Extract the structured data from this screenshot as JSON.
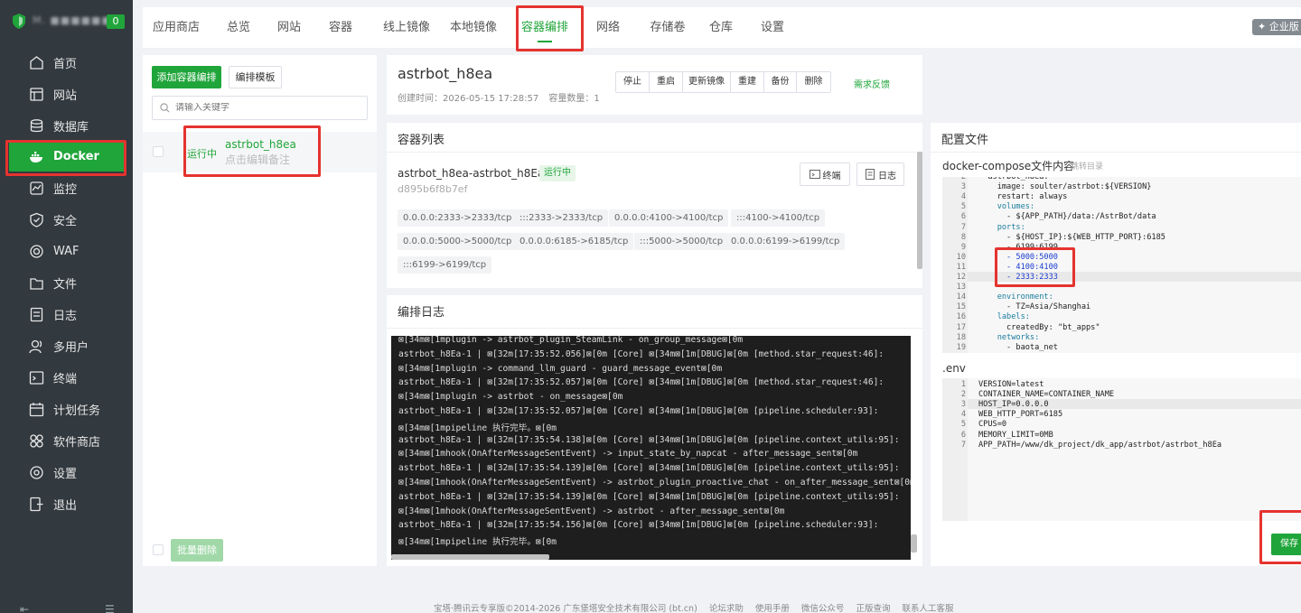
{
  "brand": {
    "name": "M. ■■■■■■",
    "badge": "0"
  },
  "sidebar": {
    "items": [
      {
        "label": "首页",
        "icon": "home-icon"
      },
      {
        "label": "网站",
        "icon": "website-icon"
      },
      {
        "label": "数据库",
        "icon": "database-icon"
      },
      {
        "label": "Docker",
        "icon": "docker-icon"
      },
      {
        "label": "监控",
        "icon": "monitor-icon"
      },
      {
        "label": "安全",
        "icon": "shield-icon"
      },
      {
        "label": "WAF",
        "icon": "waf-icon"
      },
      {
        "label": "文件",
        "icon": "folder-icon"
      },
      {
        "label": "日志",
        "icon": "log-icon"
      },
      {
        "label": "多用户",
        "icon": "user-icon"
      },
      {
        "label": "终端",
        "icon": "terminal-icon"
      },
      {
        "label": "计划任务",
        "icon": "calendar-icon"
      },
      {
        "label": "软件商店",
        "icon": "apps-icon"
      },
      {
        "label": "设置",
        "icon": "gear-icon"
      },
      {
        "label": "退出",
        "icon": "exit-icon"
      }
    ],
    "active": "Docker"
  },
  "tabs": [
    "应用商店",
    "总览",
    "网站",
    "容器",
    "线上镜像",
    "本地镜像",
    "容器编排",
    "网络",
    "存储卷",
    "仓库",
    "设置"
  ],
  "active_tab": "容器编排",
  "enterprise_label": "企业版",
  "left": {
    "add_button": "添加容器编排",
    "template_button": "编排模板",
    "search_placeholder": "请输入关键字",
    "item": {
      "status": "运行中",
      "name": "astrbot_h8ea",
      "note": "点击编辑备注"
    },
    "batch_delete": "批量删除"
  },
  "detail": {
    "title": "astrbot_h8ea",
    "created_label": "创建时间：",
    "created_value": "2026-05-15 17:28:57",
    "count_label": "容量数量：",
    "count_value": "1",
    "actions": [
      "停止",
      "重启",
      "更新镜像",
      "重建",
      "备份",
      "删除"
    ],
    "feedback": "需求反馈"
  },
  "containers": {
    "title": "容器列表",
    "name": "astrbot_h8ea-astrbot_h8Ea-1",
    "status": "运行中",
    "id": "d895b6f8b7ef",
    "terminal_btn": "终端",
    "log_btn": "日志",
    "ports": [
      "0.0.0.0:2333->2333/tcp",
      ":::2333->2333/tcp",
      "0.0.0.0:4100->4100/tcp",
      ":::4100->4100/tcp",
      "0.0.0.0:5000->5000/tcp",
      "0.0.0.0:6185->6185/tcp",
      ":::5000->5000/tcp",
      "0.0.0.0:6199->6199/tcp",
      ":::6199->6199/tcp"
    ]
  },
  "log": {
    "title": "编排日志",
    "lines": [
      "⊠[34m⊠[1mplugin -> astrbot_plugin_SteamLink - on_group_message⊠[0m",
      "astrbot_h8Ea-1 | ⊠[32m[17:35:52.056]⊠[0m [Core] ⊠[34m⊠[1m[DBUG]⊠[0m [method.star_request:46]:",
      "⊠[34m⊠[1mplugin -> command_llm_guard - guard_message_event⊠[0m",
      "astrbot_h8Ea-1 | ⊠[32m[17:35:52.057]⊠[0m [Core] ⊠[34m⊠[1m[DBUG]⊠[0m [method.star_request:46]:",
      "⊠[34m⊠[1mplugin -> astrbot - on_message⊠[0m",
      "astrbot_h8Ea-1 | ⊠[32m[17:35:52.057]⊠[0m [Core] ⊠[34m⊠[1m[DBUG]⊠[0m [pipeline.scheduler:93]:",
      "⊠[34m⊠[1mpipeline 执行完毕。⊠[0m",
      "astrbot_h8Ea-1 | ⊠[32m[17:35:54.138]⊠[0m [Core] ⊠[34m⊠[1m[DBUG]⊠[0m [pipeline.context_utils:95]:",
      "⊠[34m⊠[1mhook(OnAfterMessageSentEvent) -> input_state_by_napcat - after_message_sent⊠[0m",
      "astrbot_h8Ea-1 | ⊠[32m[17:35:54.139]⊠[0m [Core] ⊠[34m⊠[1m[DBUG]⊠[0m [pipeline.context_utils:95]:",
      "⊠[34m⊠[1mhook(OnAfterMessageSentEvent) -> astrbot_plugin_proactive_chat - on_after_message_sent⊠[0m",
      "astrbot_h8Ea-1 | ⊠[32m[17:35:54.139]⊠[0m [Core] ⊠[34m⊠[1m[DBUG]⊠[0m [pipeline.context_utils:95]:",
      "⊠[34m⊠[1mhook(OnAfterMessageSentEvent) -> astrbot - after_message_sent⊠[0m",
      "astrbot_h8Ea-1 | ⊠[32m[17:35:54.156]⊠[0m [Core] ⊠[34m⊠[1m[DBUG]⊠[0m [pipeline.scheduler:93]:",
      "⊠[34m⊠[1mpipeline 执行完毕。⊠[0m"
    ]
  },
  "config": {
    "title": "配置文件",
    "compose_label": "docker-compose文件内容",
    "jump_link": "跳转目录",
    "compose_lines": [
      {
        "n": "2",
        "t": "  astrbot_h8ea:"
      },
      {
        "n": "3",
        "t": "    image: soulter/astrbot:${VERSION}"
      },
      {
        "n": "4",
        "t": "    restart: always"
      },
      {
        "n": "5",
        "t": "    volumes:"
      },
      {
        "n": "6",
        "t": "      - ${APP_PATH}/data:/AstrBot/data"
      },
      {
        "n": "7",
        "t": "    ports:"
      },
      {
        "n": "8",
        "t": "      - ${HOST_IP}:${WEB_HTTP_PORT}:6185"
      },
      {
        "n": "9",
        "t": "      - 6199:6199"
      },
      {
        "n": "10",
        "t": "      - 5000:5000"
      },
      {
        "n": "11",
        "t": "      - 4100:4100"
      },
      {
        "n": "12",
        "t": "      - 2333:2333"
      },
      {
        "n": "13",
        "t": ""
      },
      {
        "n": "14",
        "t": "    environment:"
      },
      {
        "n": "15",
        "t": "      - TZ=Asia/Shanghai"
      },
      {
        "n": "16",
        "t": "    labels:"
      },
      {
        "n": "17",
        "t": "      createdBy: \"bt_apps\""
      },
      {
        "n": "18",
        "t": "    networks:"
      },
      {
        "n": "19",
        "t": "      - baota_net"
      }
    ],
    "env_label": ".env",
    "env_lines": [
      {
        "n": "1",
        "t": "VERSION=latest"
      },
      {
        "n": "2",
        "t": "CONTAINER_NAME=CONTAINER_NAME"
      },
      {
        "n": "3",
        "t": "HOST_IP=0.0.0.0"
      },
      {
        "n": "4",
        "t": "WEB_HTTP_PORT=6185"
      },
      {
        "n": "5",
        "t": "CPUS=0"
      },
      {
        "n": "6",
        "t": "MEMORY_LIMIT=0MB"
      },
      {
        "n": "7",
        "t": "APP_PATH=/www/dk_project/dk_app/astrbot/astrbot_h8Ea"
      }
    ],
    "save_button": "保存"
  },
  "footer": {
    "copyright": "宝塔·腾讯云专享版©2014-2026 广东堡塔安全技术有限公司 (bt.cn)",
    "links": [
      "论坛求助",
      "使用手册",
      "微信公众号",
      "正版查询",
      "联系人工客服"
    ]
  },
  "colors": {
    "accent": "#20a53a",
    "sidebar_bg": "#32393f",
    "annotation": "#e5332f"
  }
}
